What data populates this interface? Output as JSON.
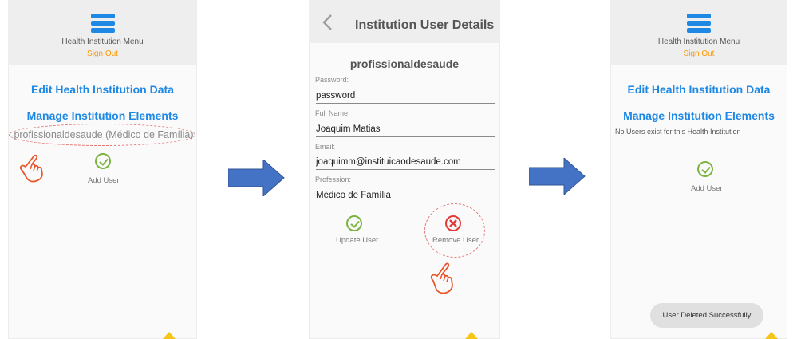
{
  "screen1": {
    "menu_title": "Health Institution Menu",
    "sign_out": "Sign Out",
    "edit_data": "Edit Health Institution Data",
    "manage_elements": "Manage Institution Elements",
    "user_entry": "profissionaldesaude (Médico de Família)",
    "add_user": "Add User"
  },
  "screen2": {
    "title": "Institution User Details",
    "username": "profissionaldesaude",
    "password_label": "Password:",
    "password_value": "password",
    "fullname_label": "Full Name:",
    "fullname_value": "Joaquim Matias",
    "email_label": "Email:",
    "email_value": "joaquimm@instituicaodesaude.com",
    "profession_label": "Profession:",
    "profession_value": "Médico de Família",
    "update_user": "Update User",
    "remove_user": "Remove User"
  },
  "screen3": {
    "menu_title": "Health Institution Menu",
    "sign_out": "Sign Out",
    "edit_data": "Edit Health Institution Data",
    "manage_elements": "Manage Institution Elements",
    "no_users": "No Users exist for this Health Institution",
    "add_user": "Add User",
    "toast": "User Deleted Successfully"
  },
  "colors": {
    "accent_blue": "#1e88e5",
    "sign_out_orange": "#ff9800",
    "check_green": "#7cb342",
    "remove_red": "#e53935",
    "arrow_blue": "#4472c4",
    "hand_orange": "#e8562a",
    "corner_yellow": "#f5c518"
  },
  "icons": [
    "hamburger-menu-icon",
    "check-circle-icon",
    "x-circle-icon",
    "back-chevron-icon",
    "pointing-hand-icon",
    "right-arrow-icon"
  ]
}
